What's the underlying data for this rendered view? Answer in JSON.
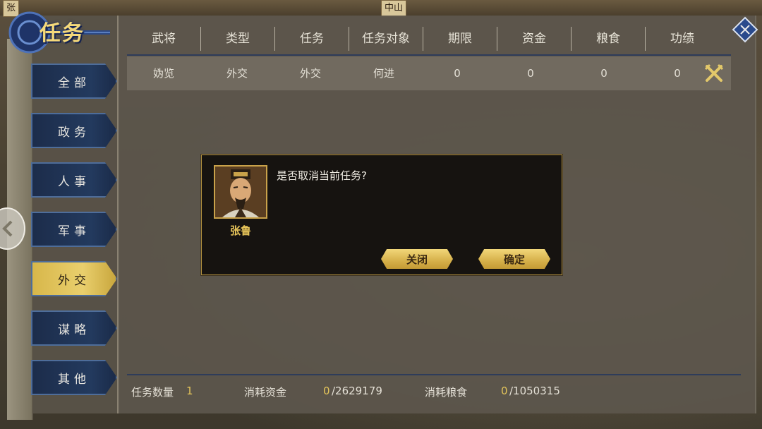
{
  "map": {
    "labels": [
      "张",
      "中山"
    ]
  },
  "panel_title": "任务",
  "categories": [
    {
      "label": "全部",
      "active": false
    },
    {
      "label": "政务",
      "active": false
    },
    {
      "label": "人事",
      "active": false
    },
    {
      "label": "军事",
      "active": false
    },
    {
      "label": "外交",
      "active": true
    },
    {
      "label": "谋略",
      "active": false
    },
    {
      "label": "其他",
      "active": false
    }
  ],
  "table": {
    "headers": [
      "武将",
      "类型",
      "任务",
      "任务对象",
      "期限",
      "资金",
      "粮食",
      "功绩"
    ],
    "rows": [
      {
        "cells": [
          "妫览",
          "外交",
          "外交",
          "何进",
          "0",
          "0",
          "0",
          "0"
        ]
      }
    ]
  },
  "footer": {
    "task_count_label": "任务数量",
    "task_count_value": "1",
    "funds_label": "消耗资金",
    "funds_used": "0",
    "funds_total": "/2629179",
    "food_label": "消耗粮食",
    "food_used": "0",
    "food_total": "/1050315"
  },
  "dialog": {
    "message": "是否取消当前任务?",
    "hero_name": "张鲁",
    "close_label": "关闭",
    "confirm_label": "确定"
  },
  "colors": {
    "gold": "#e3c45a",
    "nav_blue": "#233a5e",
    "active_gold": "#e9cf6d"
  },
  "icons": {
    "row_cancel": "crossed-swords-icon",
    "side_toggle": "chevron-left-icon",
    "corner": "scroll-badge-icon"
  }
}
